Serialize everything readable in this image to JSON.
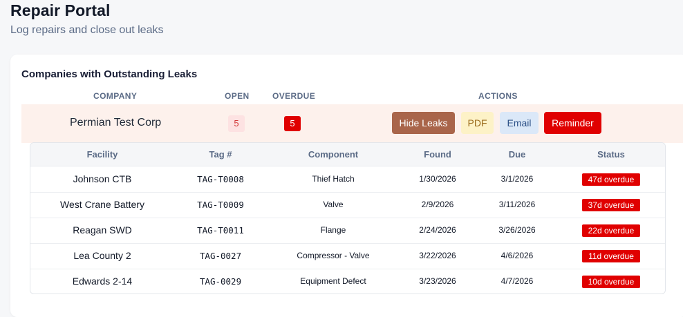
{
  "page": {
    "title": "Repair Portal",
    "subtitle": "Log repairs and close out leaks"
  },
  "card": {
    "title": "Companies with Outstanding Leaks",
    "columns": {
      "company": "COMPANY",
      "open": "OPEN",
      "overdue": "OVERDUE",
      "actions": "ACTIONS"
    }
  },
  "company": {
    "name": "Permian Test Corp",
    "open": "5",
    "overdue": "5",
    "buttons": {
      "hide": "Hide Leaks",
      "pdf": "PDF",
      "email": "Email",
      "reminder": "Reminder"
    },
    "colors": {
      "hide": "#a9654a",
      "pdf": "#fdf2c7",
      "email": "#dbe8f8",
      "reminder": "#e00000"
    }
  },
  "leaks": {
    "columns": [
      "Facility",
      "Tag #",
      "Component",
      "Found",
      "Due",
      "Status"
    ],
    "rows": [
      {
        "facility": "Johnson CTB",
        "tag": "TAG-T0008",
        "component": "Thief Hatch",
        "found": "1/30/2026",
        "due": "3/1/2026",
        "status": "47d overdue"
      },
      {
        "facility": "West Crane Battery",
        "tag": "TAG-T0009",
        "component": "Valve",
        "found": "2/9/2026",
        "due": "3/11/2026",
        "status": "37d overdue"
      },
      {
        "facility": "Reagan SWD",
        "tag": "TAG-T0011",
        "component": "Flange",
        "found": "2/24/2026",
        "due": "3/26/2026",
        "status": "22d overdue"
      },
      {
        "facility": "Lea County 2",
        "tag": "TAG-0027",
        "component": "Compressor - Valve",
        "found": "3/22/2026",
        "due": "4/6/2026",
        "status": "11d overdue"
      },
      {
        "facility": "Edwards 2-14",
        "tag": "TAG-0029",
        "component": "Equipment Defect",
        "found": "3/23/2026",
        "due": "4/7/2026",
        "status": "10d overdue"
      }
    ]
  }
}
